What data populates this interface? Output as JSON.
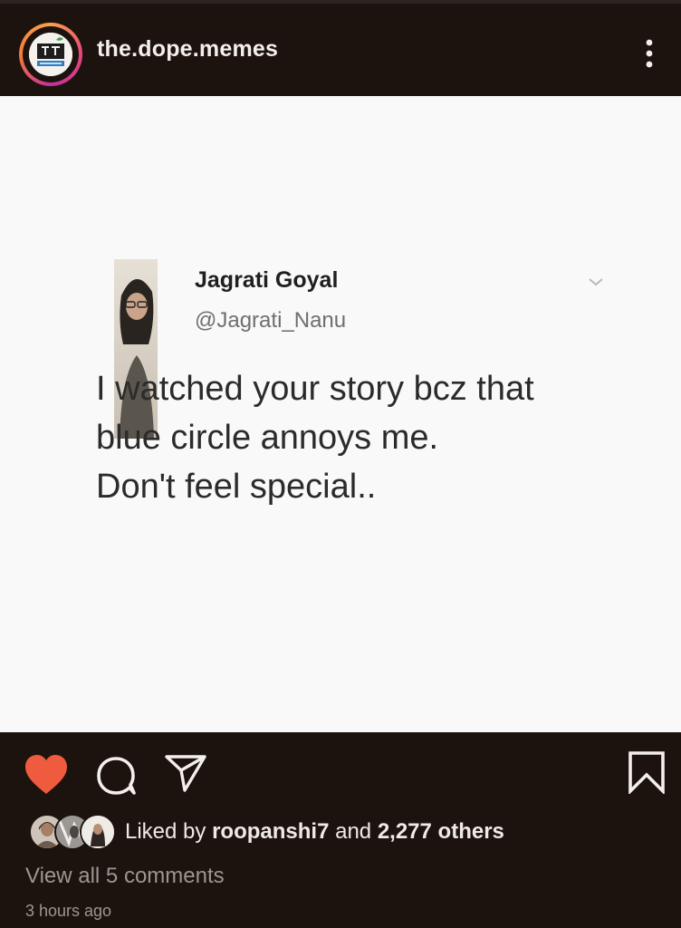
{
  "header": {
    "username": "the.dope.memes",
    "avatar_icon": "the-dope-memes-logo",
    "more_icon": "more-vertical-icon"
  },
  "post": {
    "tweet": {
      "author_name": "Jagrati Goyal",
      "author_handle": "@Jagrati_Nanu",
      "text_lines": [
        "I watched your story bcz that",
        "blue circle annoys me.",
        "Don't feel special.."
      ]
    }
  },
  "actions": {
    "like_icon": "heart-filled-icon",
    "like_color": "#ee5b3f",
    "comment_icon": "comment-icon",
    "share_icon": "send-icon",
    "save_icon": "bookmark-icon"
  },
  "likes": {
    "prefix": "Liked by ",
    "user": "roopanshi7",
    "middle": " and ",
    "others": "2,277 others"
  },
  "comments": {
    "view_all": "View all 5 comments"
  },
  "timestamp": "3 hours ago",
  "colors": {
    "background": "#1c130f",
    "post_background": "#f9f9f9",
    "text_primary": "#f3efec",
    "text_secondary": "#9d9590"
  }
}
